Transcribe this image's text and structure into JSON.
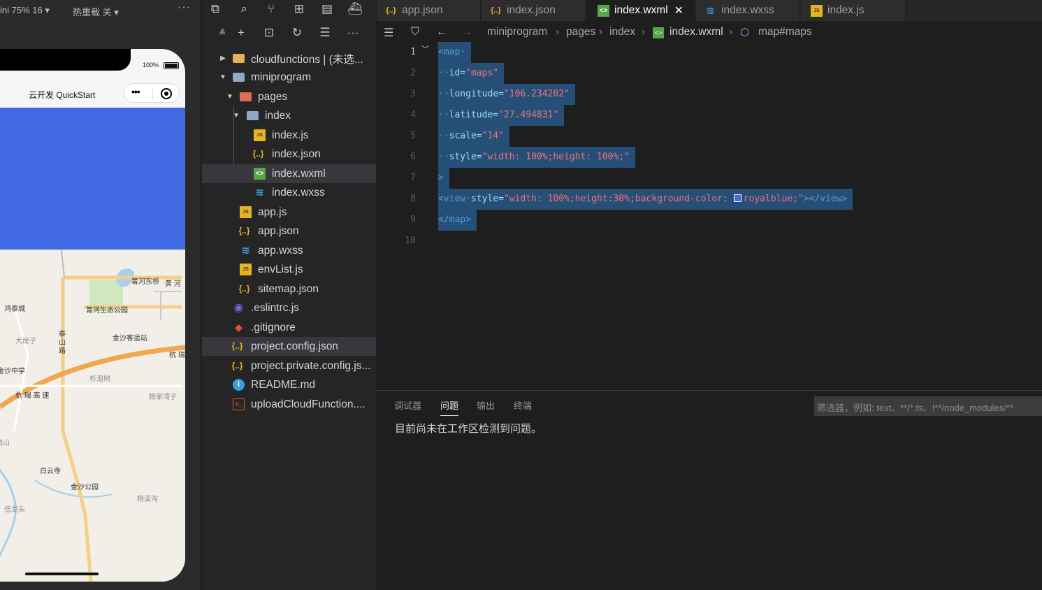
{
  "simulator": {
    "device_label": "ini 75% 16 ▾",
    "reload_label": "热重载 关 ▾",
    "more": "···",
    "battery_pct": "100%",
    "nav_title": "云开发 QuickStart",
    "view_color": "#4169e1",
    "map_labels": {
      "l1": "箐河东桥",
      "l2": "黄 河",
      "l3": "鸿泰城",
      "l4": "箐河生态公园",
      "l5": "泰",
      "l6": "山",
      "l7": "路",
      "l8": "金沙客运站",
      "l9": "大房子",
      "l10": "杭 瑞",
      "l11": "金沙中学",
      "l12": "杉泡树",
      "l13": "杭 瑞 高 速",
      "l14": "杨家湾子",
      "l15": "鹅山",
      "l16": "白云寺",
      "l17": "金沙公园",
      "l18": "杨溪沟",
      "l19": "伍龙头"
    }
  },
  "explorer": {
    "tree": [
      {
        "label": "cloudfunctions | (未选...",
        "kind": "folder"
      },
      {
        "label": "miniprogram",
        "kind": "folder"
      },
      {
        "label": "pages",
        "kind": "folder"
      },
      {
        "label": "index",
        "kind": "folder"
      },
      {
        "label": "index.js",
        "kind": "js"
      },
      {
        "label": "index.json",
        "kind": "json"
      },
      {
        "label": "index.wxml",
        "kind": "wxml"
      },
      {
        "label": "index.wxss",
        "kind": "wxss"
      },
      {
        "label": "app.js",
        "kind": "js"
      },
      {
        "label": "app.json",
        "kind": "json"
      },
      {
        "label": "app.wxss",
        "kind": "wxss"
      },
      {
        "label": "envList.js",
        "kind": "js"
      },
      {
        "label": "sitemap.json",
        "kind": "json"
      },
      {
        "label": ".eslintrc.js",
        "kind": "eslint"
      },
      {
        "label": ".gitignore",
        "kind": "git"
      },
      {
        "label": "project.config.json",
        "kind": "json"
      },
      {
        "label": "project.private.config.js...",
        "kind": "json"
      },
      {
        "label": "README.md",
        "kind": "info"
      },
      {
        "label": "uploadCloudFunction....",
        "kind": "sh"
      }
    ]
  },
  "editor": {
    "tabs": [
      {
        "label": "app.json",
        "kind": "json"
      },
      {
        "label": "index.json",
        "kind": "json"
      },
      {
        "label": "index.wxml",
        "kind": "wxml"
      },
      {
        "label": "index.wxss",
        "kind": "wxss"
      },
      {
        "label": "index.js",
        "kind": "js"
      }
    ],
    "breadcrumb": [
      "miniprogram",
      "pages",
      "index",
      "index.wxml",
      "map#maps"
    ],
    "line_numbers": [
      "1",
      "2",
      "3",
      "4",
      "5",
      "6",
      "7",
      "8",
      "9",
      "10"
    ],
    "code": {
      "l1_tag": "<map",
      "l2_attr": "id=",
      "l2_val": "\"maps\"",
      "l3_attr": "longitude=",
      "l3_val": "\"106.234202\"",
      "l4_attr": "latitude=",
      "l4_val": "\"27.494831\"",
      "l5_attr": "scale=",
      "l5_val": "\"14\"",
      "l6_attr": "style=",
      "l6_val": "\"width: 100%;height: 100%;\"",
      "l7_tag": ">",
      "l8_open": "<view",
      "l8_attr": "style=",
      "l8_val_a": "\"width: 100%;height:30%;background-color: ",
      "l8_val_b": "royalblue;\"",
      "l8_close": "></view>",
      "l9_tag": "</map>"
    }
  },
  "panel": {
    "tabs": [
      "调试器",
      "问题",
      "输出",
      "终端"
    ],
    "active_tab": "问题",
    "filter_placeholder": "筛选器，例如: text、**/*.ts、!**/node_modules/**",
    "message": "目前尚未在工作区检测到问题。"
  }
}
